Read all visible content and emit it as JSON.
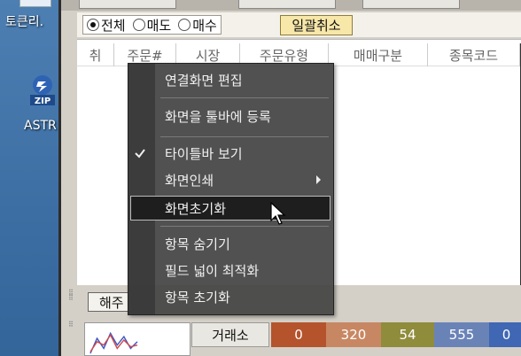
{
  "desktop": {
    "label_top": "토큰리.",
    "zip_text": "ZIP",
    "label_astr": "ASTR"
  },
  "filter": {
    "options": [
      {
        "label": "전체",
        "selected": true
      },
      {
        "label": "매도",
        "selected": false
      },
      {
        "label": "매수",
        "selected": false
      }
    ],
    "cancel_all_label": "일괄취소"
  },
  "grid": {
    "columns": [
      "취",
      "주문#",
      "시장",
      "주문유형",
      "매매구분",
      "종목코드"
    ]
  },
  "bottom": {
    "summary_button_label": "해주",
    "exchange_label": "거래소",
    "stats": [
      {
        "value": "0",
        "color": "#b5532c"
      },
      {
        "value": "320",
        "color": "#c88763"
      },
      {
        "value": "54",
        "color": "#8f8c3c"
      },
      {
        "value": "555",
        "color": "#6a83b7"
      },
      {
        "value": "0",
        "color": "#3f67b3"
      }
    ]
  },
  "context_menu": {
    "items": [
      {
        "label": "연결화면 편집"
      },
      {
        "label": "화면을 툴바에 등록"
      },
      {
        "label": "타이틀바 보기",
        "checked": true
      },
      {
        "label": "화면인쇄",
        "submenu": true
      },
      {
        "label": "화면초기화",
        "highlighted": true
      },
      {
        "label": "항목 숨기기"
      },
      {
        "label": "필드 넓이 최적화"
      },
      {
        "label": "항목 초기화"
      }
    ]
  },
  "colors": {
    "menu_bg": "#444444",
    "highlight_bg": "#1e1e1e",
    "cancel_btn": "#f7e7a9"
  }
}
